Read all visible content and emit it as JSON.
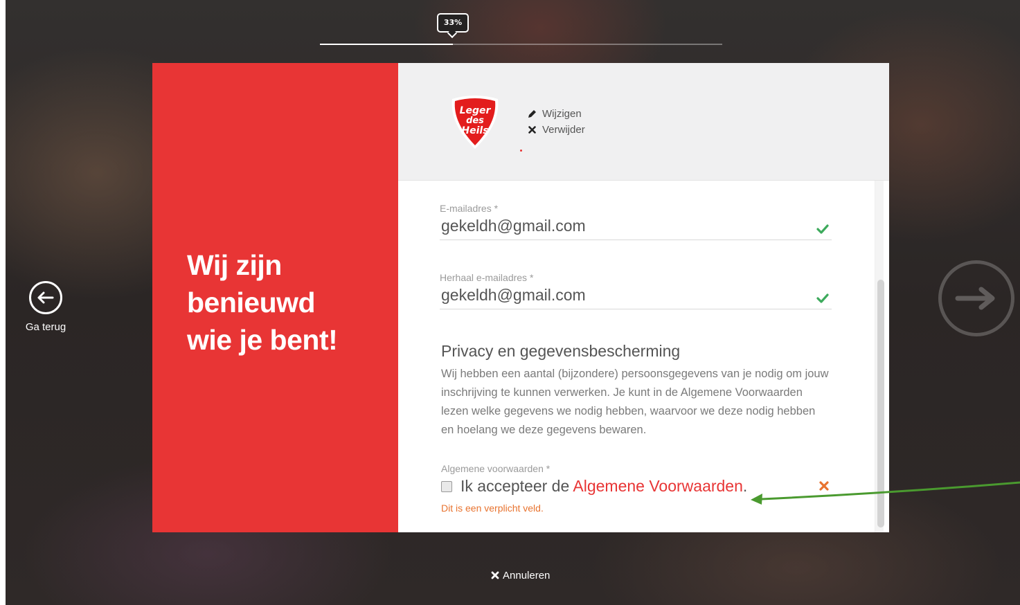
{
  "progress": {
    "label": "33%",
    "value": 0.33
  },
  "nav": {
    "back_label": "Ga terug"
  },
  "heading": {
    "line1": "Wij zijn",
    "line2": "benieuwd",
    "line3": "wie je bent!"
  },
  "logo": {
    "text_line1": "Leger",
    "text_line2": "des",
    "text_line3": "Heils",
    "edit_label": "Wijzigen",
    "remove_label": "Verwijder"
  },
  "form": {
    "email": {
      "label": "E-mailadres *",
      "value": "gekeldh@gmail.com"
    },
    "email_repeat": {
      "label": "Herhaal e-mailadres *",
      "value": "gekeldh@gmail.com"
    },
    "privacy": {
      "title": "Privacy en gegevensbescherming",
      "text": "Wij hebben een aantal (bijzondere) persoonsgegevens van je nodig om jouw inschrijving te kunnen verwerken. Je kunt in de Algemene Voorwaarden lezen welke gegevens we nodig hebben, waarvoor we deze nodig hebben en hoelang we deze gegevens bewaren."
    },
    "terms": {
      "label": "Algemene voorwaarden *",
      "prefix": "Ik accepteer de ",
      "link": "Algemene Voorwaarden",
      "suffix": ".",
      "error": "Dit is een verplicht veld."
    }
  },
  "footer": {
    "cancel_label": "Annuleren"
  },
  "colors": {
    "brand_red": "#e83535",
    "valid_green": "#3daa5c",
    "error_orange": "#e8732f",
    "annotation_green": "#4a9a2f"
  }
}
